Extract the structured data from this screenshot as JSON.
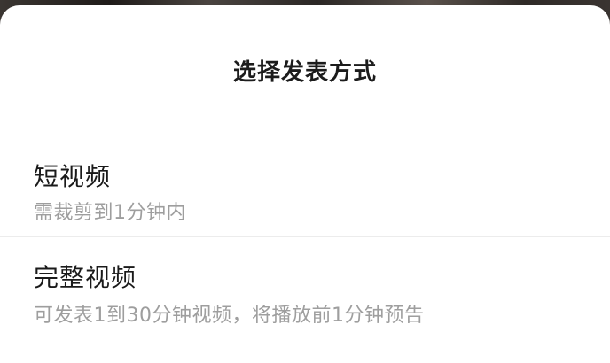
{
  "sheet": {
    "title": "选择发表方式",
    "options": [
      {
        "title": "短视频",
        "subtitle": "需裁剪到1分钟内"
      },
      {
        "title": "完整视频",
        "subtitle": "可发表1到30分钟视频，将播放前1分钟预告"
      }
    ]
  }
}
